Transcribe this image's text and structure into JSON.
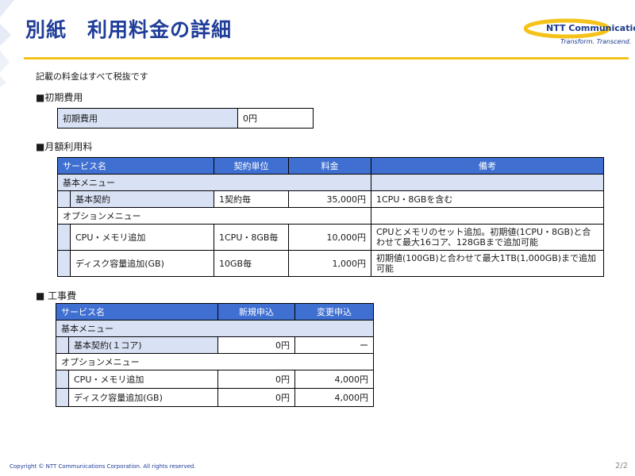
{
  "header": {
    "title": "別紙　利用料金の詳細"
  },
  "logo": {
    "name": "NTT Communications",
    "tagline": "Transform. Transcend."
  },
  "note": "記載の料金はすべて税抜です",
  "sections": {
    "initial": "■初期費用",
    "monthly": "■月額利用料",
    "construction": "■ 工事費"
  },
  "initial_table": {
    "label": "初期費用",
    "value": "0円"
  },
  "monthly_table": {
    "headers": [
      "サービス名",
      "契約単位",
      "料金",
      "備考"
    ],
    "group1": "基本メニュー",
    "row1": {
      "name": "基本契約",
      "unit": "1契約毎",
      "price": "35,000円",
      "note": "1CPU・8GBを含む"
    },
    "group2": "オプションメニュー",
    "row2": {
      "name": "CPU・メモリ追加",
      "unit": "1CPU・8GB毎",
      "price": "10,000円",
      "note": "CPUとメモリのセット追加。初期値(1CPU・8GB)と合わせて最大16コア、128GBまで追加可能"
    },
    "row3": {
      "name": "ディスク容量追加(GB)",
      "unit": "10GB毎",
      "price": "1,000円",
      "note": "初期値(100GB)と合わせて最大1TB(1,000GB)まで追加可能"
    }
  },
  "construction_table": {
    "headers": [
      "サービス名",
      "新規申込",
      "変更申込"
    ],
    "group1": "基本メニュー",
    "row1": {
      "name": "基本契約(１コア)",
      "new": "0円",
      "change": "ー"
    },
    "group2": "オプションメニュー",
    "row2": {
      "name": "CPU・メモリ追加",
      "new": "0円",
      "change": "4,000円"
    },
    "row3": {
      "name": "ディスク容量追加(GB)",
      "new": "0円",
      "change": "4,000円"
    }
  },
  "footer": {
    "copyright": "Copyright © NTT Communications Corporation. All rights reserved.",
    "page": "2/2"
  }
}
